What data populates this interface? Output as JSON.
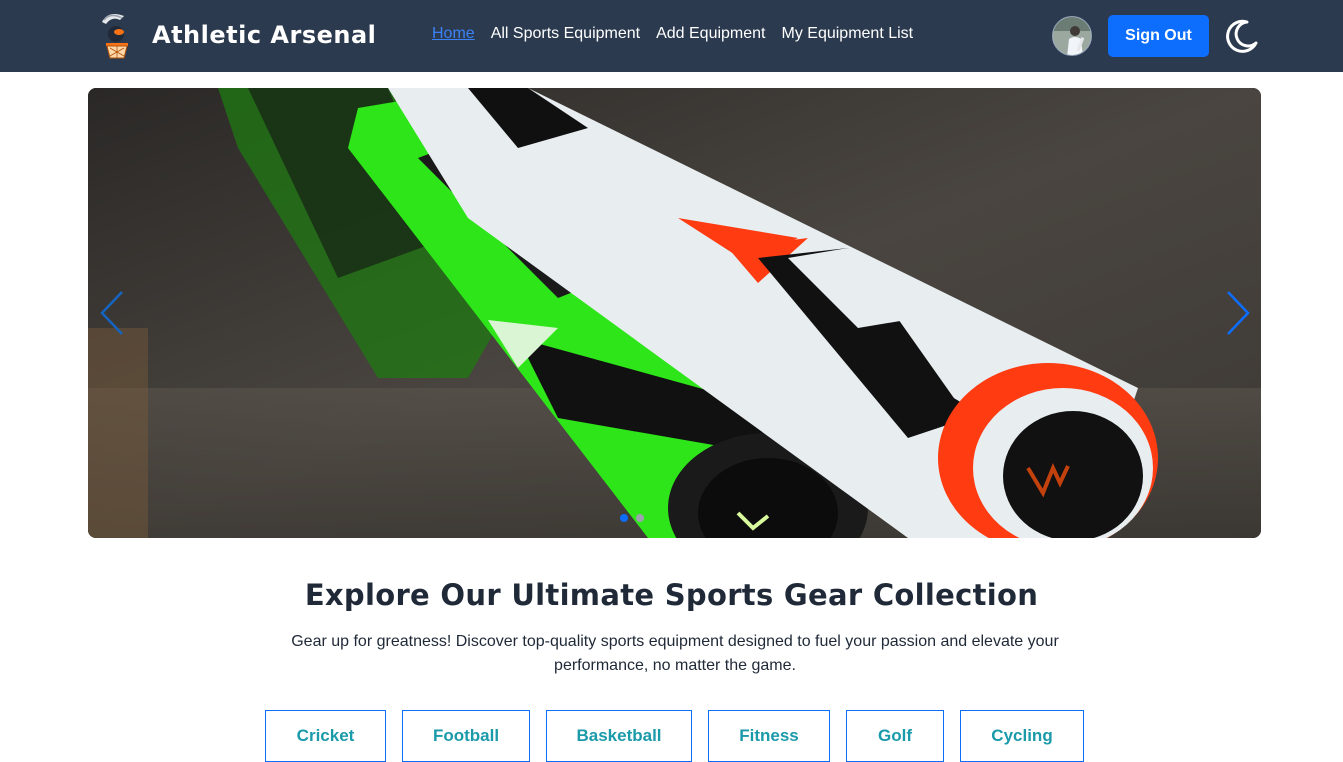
{
  "navbar": {
    "brand_name": "Athletic Arsenal",
    "links": [
      {
        "label": "Home",
        "active": true
      },
      {
        "label": "All Sports Equipment",
        "active": false
      },
      {
        "label": "Add Equipment",
        "active": false
      },
      {
        "label": "My Equipment List",
        "active": false
      }
    ],
    "sign_out_label": "Sign Out",
    "theme_icon": "moon-icon",
    "accent_color": "#0d6efd",
    "background_color": "#2b3a4e"
  },
  "carousel": {
    "active_slide": 1,
    "slide_count": 2,
    "prev_icon": "chevron-left-icon",
    "next_icon": "chevron-right-icon"
  },
  "section": {
    "title": "Explore Our Ultimate Sports Gear Collection",
    "description": "Gear up for greatness! Discover top-quality sports equipment designed to fuel your passion and elevate your performance, no matter the game."
  },
  "categories": [
    "Cricket",
    "Football",
    "Basketball",
    "Fitness",
    "Golf",
    "Cycling"
  ]
}
